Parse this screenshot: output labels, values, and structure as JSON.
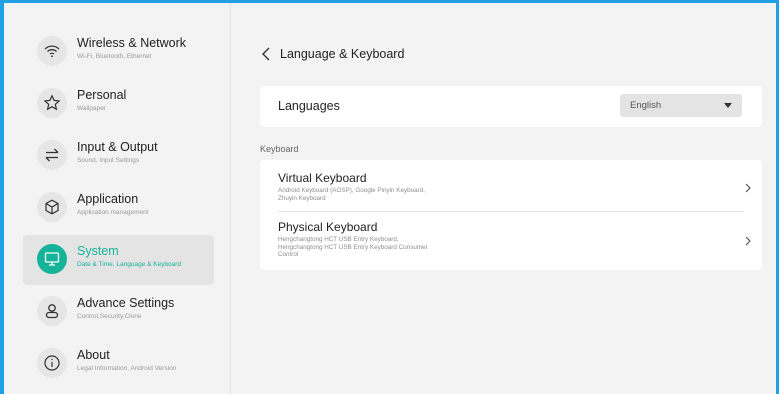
{
  "sidebar": {
    "items": [
      {
        "icon": "wifi-icon",
        "title": "Wireless & Network",
        "subtitle": "Wi-Fi, Bluetooth, Ethernet",
        "active": false
      },
      {
        "icon": "star-icon",
        "title": "Personal",
        "subtitle": "Wallpaper",
        "active": false
      },
      {
        "icon": "arrows-icon",
        "title": "Input & Output",
        "subtitle": "Sound, Input Settings",
        "active": false
      },
      {
        "icon": "cube-icon",
        "title": "Application",
        "subtitle": "Application management",
        "active": false
      },
      {
        "icon": "monitor-icon",
        "title": "System",
        "subtitle": "Date & Time, Language & Keyboard",
        "active": true
      },
      {
        "icon": "person-icon",
        "title": "Advance Settings",
        "subtitle": "Control,Security,Clone",
        "active": false
      },
      {
        "icon": "info-icon",
        "title": "About",
        "subtitle": "Legal Information, Android Version",
        "active": false
      }
    ]
  },
  "header": {
    "back_icon": "chevron-left-icon",
    "title": "Language & Keyboard"
  },
  "languages": {
    "label": "Languages",
    "selected": "English",
    "caret_icon": "caret-down-icon"
  },
  "keyboard": {
    "section_label": "Keyboard",
    "rows": [
      {
        "title": "Virtual Keyboard",
        "subtitle_lines": [
          "Android Keyboard (AOSP), Google Pinyin Keyboard,",
          "Zhuyin Keyboard"
        ]
      },
      {
        "title": "Physical Keyboard",
        "subtitle_lines": [
          "Hengchangtong  HCT USB Entry Keyboard,",
          "Hengchangtong  HCT USB Entry Keyboard Consumer",
          "Control"
        ]
      }
    ]
  },
  "colors": {
    "accent": "#14b39a",
    "frame": "#22a0e6",
    "background": "#f3f3f3"
  }
}
